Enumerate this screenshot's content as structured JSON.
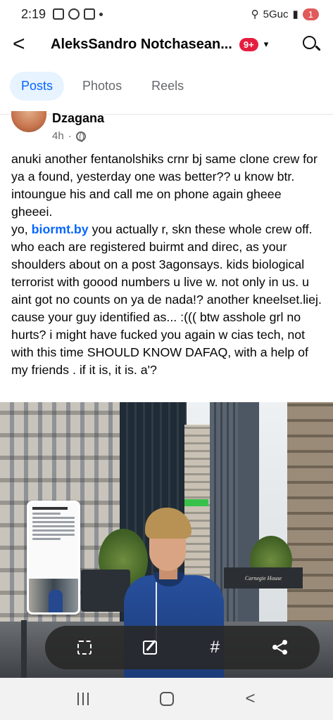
{
  "status_bar": {
    "time": "2:19",
    "network": "5Guc",
    "battery": "1"
  },
  "header": {
    "back_glyph": "<",
    "title": "AleksSandro Notchasean...",
    "notification_count": "9+",
    "dropdown_glyph": "▾"
  },
  "tabs": [
    {
      "label": "Posts",
      "active": true
    },
    {
      "label": "Photos",
      "active": false
    },
    {
      "label": "Reels",
      "active": false
    }
  ],
  "post": {
    "author": "Dzagana",
    "time": "4h",
    "separator": "·",
    "text_p1": "anuki another fentanolshiks crnr bj same clone crew for ya a found, yesterday one was better?? u know btr. intoungue his and call me on phone again gheee gheeei.",
    "text_p2_prefix": "yo, ",
    "mention": "biormt.by",
    "text_p2_suffix": " you actually r, skn these whole crew off. who each are registered buirmt and direc, as your shoulders about on a post 3agonsays. kids biological terrorist with goood numbers u live w. not only in us. u aint got no counts on ya de nada!? another kneelset.liej. cause your guy identified as... :((( btw asshole grl no hurts? i might have fucked you again w cias tech, not with this time SHOULD KNOW DAFAQ, with a help of my friends . if it is, it is. a'?"
  },
  "photo": {
    "storefront_sign": "Carnegie House"
  },
  "toolbar": {
    "tag_glyph": "#"
  },
  "nav": {
    "back_glyph": "<"
  },
  "colors": {
    "accent": "#0866ff",
    "active_tab_bg": "#e7f3ff",
    "badge": "#e41e3f",
    "toolbar_bg": "#282828"
  },
  "icons": [
    "back-icon",
    "search-icon",
    "globe-icon",
    "scan-icon",
    "edit-icon",
    "hashtag-icon",
    "share-icon",
    "recents-icon",
    "home-icon",
    "back-nav-icon"
  ]
}
